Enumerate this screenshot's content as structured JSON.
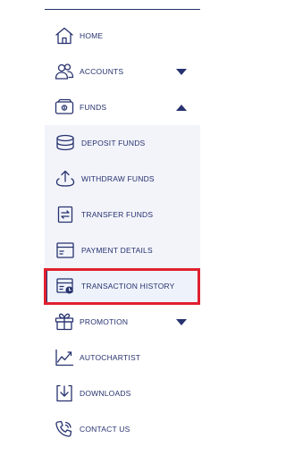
{
  "menu": {
    "home": "HOME",
    "accounts": "ACCOUNTS",
    "funds": "FUNDS",
    "deposit_funds": "DEPOSIT FUNDS",
    "withdraw_funds": "WITHDRAW FUNDS",
    "transfer_funds": "TRANSFER FUNDS",
    "payment_details": "PAYMENT DETAILS",
    "transaction_history": "TRANSACTION HISTORY",
    "promotion": "PROMOTION",
    "autochartist": "AUTOCHARTIST",
    "downloads": "DOWNLOADS",
    "contact_us": "CONTACT US"
  },
  "icons": {
    "home": "home-icon",
    "accounts": "users-icon",
    "funds": "wallet-icon",
    "deposit_funds": "coin-stack-icon",
    "withdraw_funds": "upload-tray-icon",
    "transfer_funds": "transfer-icon",
    "payment_details": "card-icon",
    "transaction_history": "history-icon",
    "promotion": "gift-icon",
    "autochartist": "chart-icon",
    "downloads": "download-icon",
    "contact_us": "phone-icon"
  },
  "colors": {
    "brand": "#27326f",
    "highlight_outline": "#e0202e",
    "submenu_background": "#f2f4fa"
  }
}
